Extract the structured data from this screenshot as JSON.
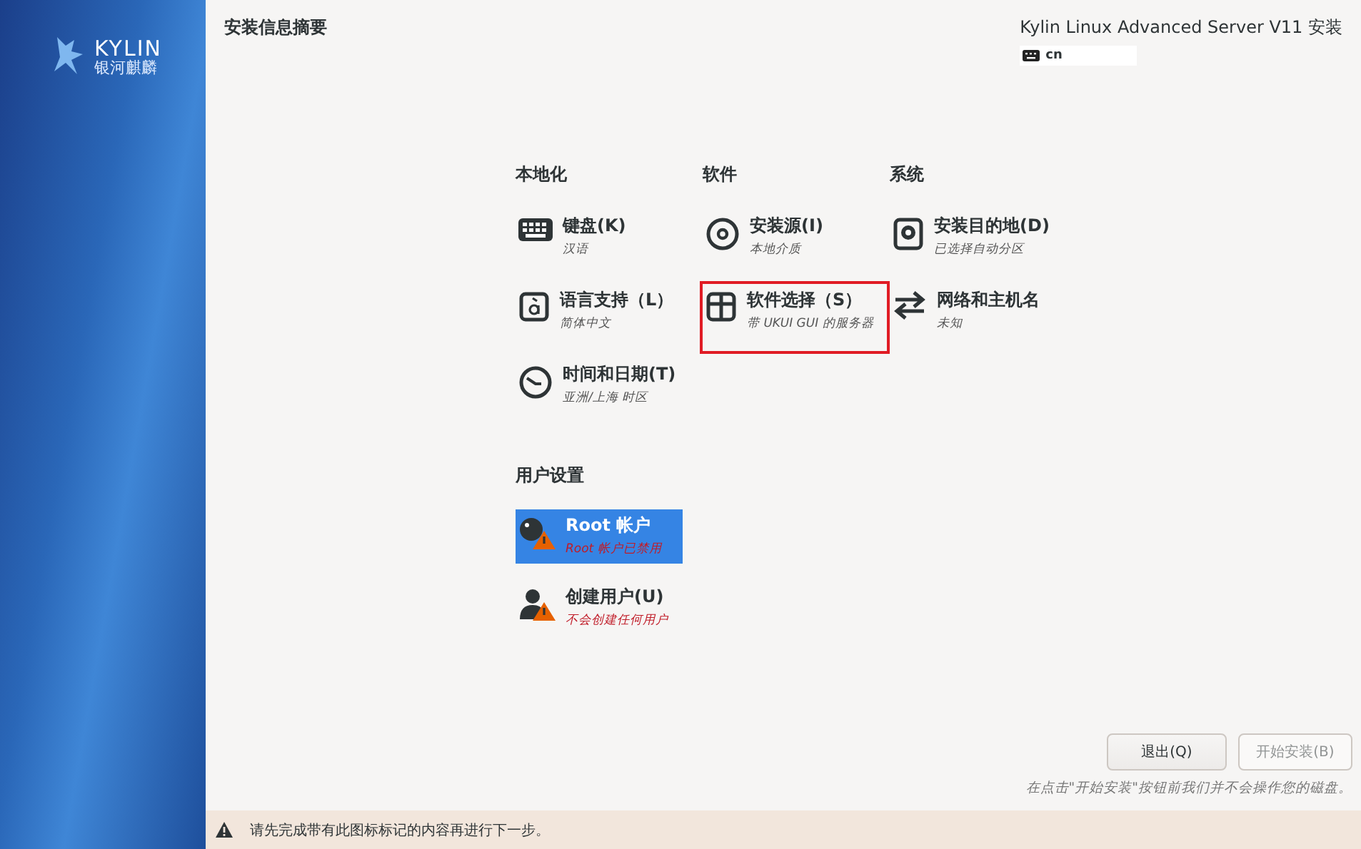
{
  "sidebar": {
    "logo_text": "KYLIN",
    "logo_subtext": "银河麒麟"
  },
  "header": {
    "title": "安装信息摘要",
    "product": "Kylin Linux Advanced Server V11 安装",
    "keyboard_layout": "cn"
  },
  "categories": [
    {
      "title": "本地化",
      "spokes": [
        {
          "title": "键盘(K)",
          "status": "汉语",
          "highlighted": false
        },
        {
          "title": "语言支持（L）",
          "status": "简体中文",
          "highlighted": false
        },
        {
          "title": "时间和日期(T)",
          "status": "亚洲/上海 时区",
          "highlighted": false
        }
      ]
    },
    {
      "title": "软件",
      "spokes": [
        {
          "title": "安装源(I)",
          "status": "本地介质",
          "highlighted": false
        },
        {
          "title": "软件选择（S）",
          "status": "带 UKUI GUI 的服务器",
          "highlighted": true
        }
      ]
    },
    {
      "title": "系统",
      "spokes": [
        {
          "title": "安装目的地(D)",
          "status": "已选择自动分区",
          "highlighted": false
        },
        {
          "title": "网络和主机名",
          "status": "未知",
          "highlighted": false
        }
      ]
    }
  ],
  "user_settings": {
    "title": "用户设置",
    "spokes": [
      {
        "title": "Root 帐户",
        "status": "Root 帐户已禁用",
        "warning": true,
        "selected": true
      },
      {
        "title": "创建用户(U)",
        "status": "不会创建任何用户",
        "warning": true,
        "selected": false
      }
    ]
  },
  "buttons": [
    {
      "label": "退出(Q)",
      "disabled": false
    },
    {
      "label": "开始安装(B)",
      "disabled": true
    }
  ],
  "note": "在点击\"开始安装\"按钮前我们并不会操作您的磁盘。",
  "warning_bar": {
    "text": "请先完成带有此图标标记的内容再进行下一步。"
  }
}
